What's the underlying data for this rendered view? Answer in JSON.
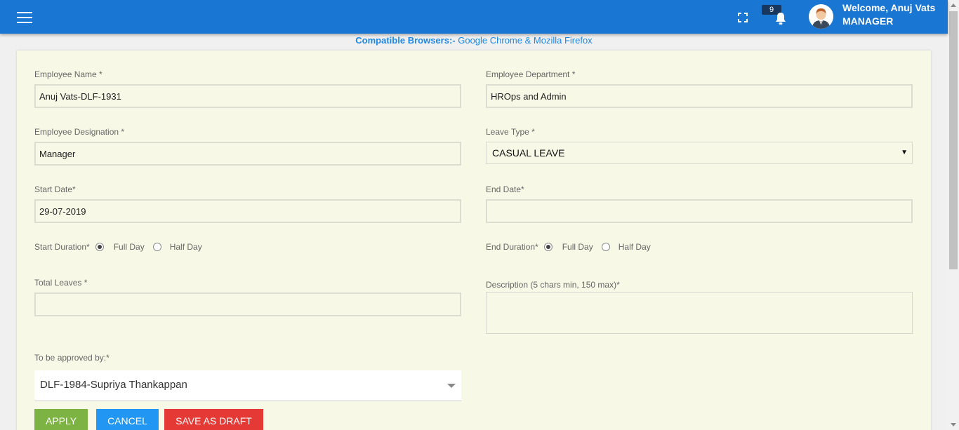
{
  "header": {
    "welcome_text": "Welcome, Anuj Vats",
    "role": "MANAGER",
    "notification_count": "9",
    "bar_color": "#1976d2"
  },
  "compat": {
    "label": "Compatible Browsers:-",
    "browsers": " Google Chrome & Mozilla Firefox"
  },
  "form": {
    "employee_name": {
      "label": "Employee Name *",
      "value": "Anuj Vats-DLF-1931"
    },
    "employee_department": {
      "label": "Employee Department *",
      "value": "HROps and Admin"
    },
    "employee_designation": {
      "label": "Employee Designation *",
      "value": "Manager"
    },
    "leave_type": {
      "label": "Leave Type *",
      "value": "CASUAL LEAVE"
    },
    "start_date": {
      "label": "Start Date*",
      "value": "29-07-2019"
    },
    "end_date": {
      "label": "End Date*",
      "value": ""
    },
    "start_duration": {
      "label": "Start Duration*",
      "full_day": "Full Day",
      "half_day": "Half Day",
      "selected": "Full Day"
    },
    "end_duration": {
      "label": "End Duration*",
      "full_day": "Full Day",
      "half_day": "Half Day",
      "selected": "Full Day"
    },
    "total_leaves": {
      "label": "Total Leaves *",
      "value": ""
    },
    "description": {
      "label": "Description (5 chars min, 150 max)*",
      "value": ""
    },
    "approver": {
      "label": "To be approved by:*",
      "value": "DLF-1984-Supriya Thankappan"
    }
  },
  "buttons": {
    "apply": "APPLY",
    "cancel": "CANCEL",
    "draft": "SAVE AS DRAFT"
  },
  "icons": {
    "menu": "hamburger-menu-icon",
    "fullscreen": "fullscreen-icon",
    "notifications": "bell-icon",
    "user": "user-avatar-icon"
  }
}
